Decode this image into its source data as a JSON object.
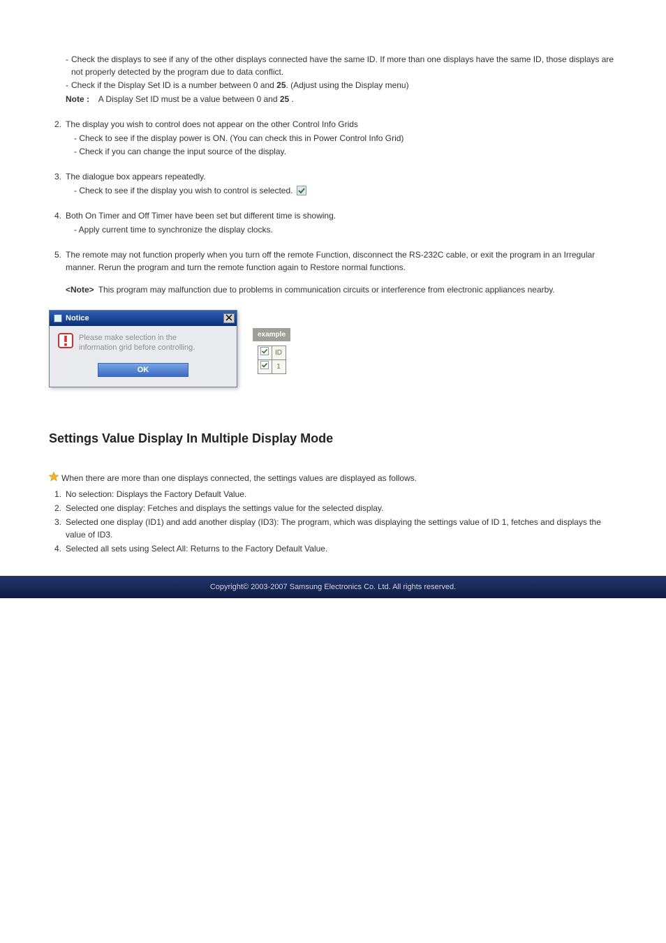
{
  "top": {
    "items": [
      "Check the displays to see if any of the other displays connected have the same ID. If more than one displays have the same ID, those displays are not properly detected by the program due to data conflict.",
      {
        "pre": "Check if the Display Set ID is a number between 0 and ",
        "bold": "25",
        "post": ". (Adjust using the Display menu)"
      }
    ],
    "note_label": "Note :",
    "note_text_pre": "A Display Set ID must be a value between 0 and ",
    "note_text_bold": "25",
    "note_text_post": " ."
  },
  "sections": [
    {
      "num": "2.",
      "title": "The display you wish to control does not appear on the other Control Info Grids",
      "subs": [
        "- Check to see if the display power is ON. (You can check this in Power Control Info Grid)",
        "- Check if you can change the input source of the display."
      ]
    },
    {
      "num": "3.",
      "title": "The dialogue box appears repeatedly.",
      "subs": [
        "- Check to see if the display you wish to control is selected."
      ],
      "trailing_checkbox": true
    },
    {
      "num": "4.",
      "title": "Both On Timer and Off Timer have been set but different time is showing.",
      "subs": [
        "- Apply current time to synchronize the display clocks."
      ]
    },
    {
      "num": "5.",
      "title": "The remote may not function properly when you turn off the remote Function, disconnect the RS-232C cable, or exit the program in an Irregular manner. Rerun the program and turn the remote function again to Restore normal functions.",
      "subs": [],
      "note": {
        "label": "<Note>",
        "text": "This program may malfunction due to problems in communication circuits or interference from electronic appliances nearby."
      }
    }
  ],
  "notice": {
    "title": "Notice",
    "close": "X",
    "line1": "Please make selection in the",
    "line2": "information grid before controlling.",
    "ok": "OK"
  },
  "example": {
    "caption": "example",
    "id_header": "ID",
    "id_value": "1"
  },
  "heading2": "Settings Value Display In Multiple Display Mode",
  "bottom": {
    "intro": "When there are more than one displays connected, the settings values are displayed as follows.",
    "items": [
      {
        "num": "1.",
        "text": "No selection: Displays the Factory Default Value."
      },
      {
        "num": "2.",
        "text": "Selected one display: Fetches and displays the settings value for the selected display."
      },
      {
        "num": "3.",
        "text": "Selected one display (ID1) and add another display (ID3): The program, which was displaying the settings value of ID 1, fetches and displays the value of ID3."
      },
      {
        "num": "4.",
        "text": "Selected all sets using Select All: Returns to the Factory Default Value."
      }
    ]
  },
  "copyright": "Copyright© 2003-2007  Samsung Electronics Co. Ltd. All rights reserved."
}
